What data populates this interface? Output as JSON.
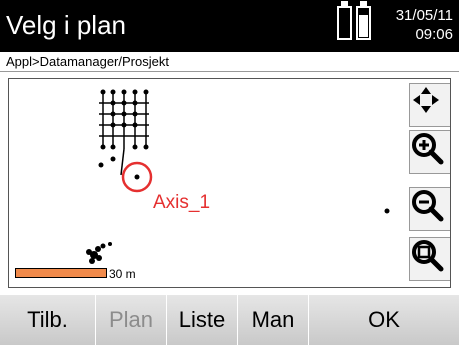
{
  "header": {
    "title": "Velg i plan",
    "date": "31/05/11",
    "time": "09:06"
  },
  "breadcrumb": "Appl>Datamanager/Prosjekt",
  "map": {
    "axis_label": "Axis_1",
    "scale_label": "30 m"
  },
  "map_tools": [
    "pan-icon",
    "zoom-in-icon",
    "zoom-out-icon",
    "zoom-fit-icon"
  ],
  "softkeys": [
    {
      "label": "Tilb.",
      "enabled": true
    },
    {
      "label": "Plan",
      "enabled": false
    },
    {
      "label": "Liste",
      "enabled": true
    },
    {
      "label": "Man",
      "enabled": true
    },
    {
      "label": "OK",
      "enabled": true
    }
  ],
  "colors": {
    "accent": "#e53030",
    "scale_bar": "#f08a4b"
  }
}
